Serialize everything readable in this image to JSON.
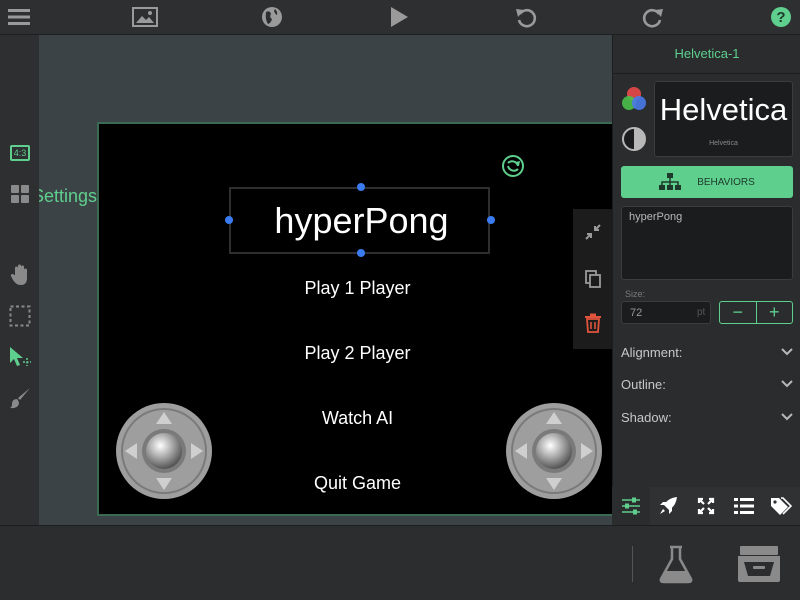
{
  "colors": {
    "accent": "#5fcf8e",
    "selection": "#3a7cf0",
    "delete": "#e0533c"
  },
  "toolbar": {
    "icons": [
      "menu-icon",
      "image-icon",
      "globe-icon",
      "play-icon",
      "undo-icon",
      "redo-icon",
      "help-icon"
    ]
  },
  "leftbar": {
    "aspect_label": "4:3",
    "icons": [
      "aspect-ratio-icon",
      "grid-icon",
      "hand-icon",
      "marquee-select-icon",
      "pointer-select-icon",
      "brush-icon"
    ]
  },
  "canvas": {
    "settings_label": "Settings",
    "title": "hyperPong",
    "menu": [
      "Play 1 Player",
      "Play 2 Player",
      "Watch AI",
      "Quit Game"
    ]
  },
  "panel": {
    "object_name": "Helvetica-1",
    "font_preview": "Helvetica",
    "font_name": "Helvetica",
    "behaviors_label": "BEHAVIORS",
    "text_value": "hyperPong",
    "size_label": "Size:",
    "size_value": "72",
    "size_unit": "pt",
    "minus": "−",
    "plus": "+",
    "alignment_label": "Alignment:",
    "outline_label": "Outline:",
    "shadow_label": "Shadow:"
  },
  "tabs": [
    "sliders-icon",
    "rocket-icon",
    "expand-icon",
    "list-icon",
    "tags-icon"
  ]
}
